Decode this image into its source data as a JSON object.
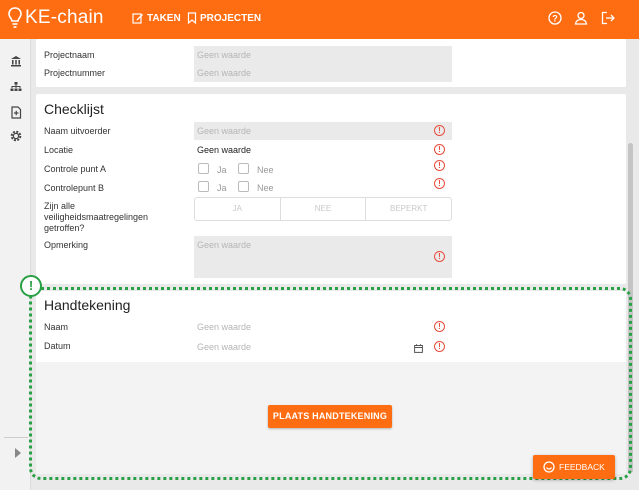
{
  "app": {
    "name": "KE-chain",
    "brand_color": "#ff6d12"
  },
  "nav": {
    "taken": "TAKEN",
    "projecten": "PROJECTEN"
  },
  "header_icons": [
    "help-icon",
    "user-icon",
    "logout-icon"
  ],
  "sidebar_icons": [
    "bank-icon",
    "sitemap-icon",
    "document-icon",
    "gear-icon"
  ],
  "project": {
    "fields": [
      {
        "label": "Projectnaam",
        "value": "Geen waarde"
      },
      {
        "label": "Projectnummer",
        "value": "Geen waarde"
      }
    ]
  },
  "checklist": {
    "title": "Checklijst",
    "naam_uitvoerder": {
      "label": "Naam uitvoerder",
      "value": "Geen waarde"
    },
    "locatie": {
      "label": "Locatie",
      "value": "Geen waarde"
    },
    "controle_a": {
      "label": "Controle punt A",
      "yes": "Ja",
      "no": "Nee"
    },
    "controle_b": {
      "label": "Controlepunt B",
      "yes": "Ja",
      "no": "Nee"
    },
    "veiligheid": {
      "label": "Zijn alle veiligheidsmaatregelingen getroffen?",
      "options": [
        "JA",
        "NEE",
        "BEPERKT"
      ]
    },
    "opmerking": {
      "label": "Opmerking",
      "value": "Geen waarde"
    }
  },
  "signature": {
    "title": "Handtekening",
    "naam": {
      "label": "Naam",
      "value": "Geen waarde"
    },
    "datum": {
      "label": "Datum",
      "value": "Geen waarde"
    },
    "button": "PLAATS HANDTEKENING"
  },
  "highlight_badge": "!",
  "highlight_color": "#2aa046",
  "feedback": "FEEDBACK"
}
